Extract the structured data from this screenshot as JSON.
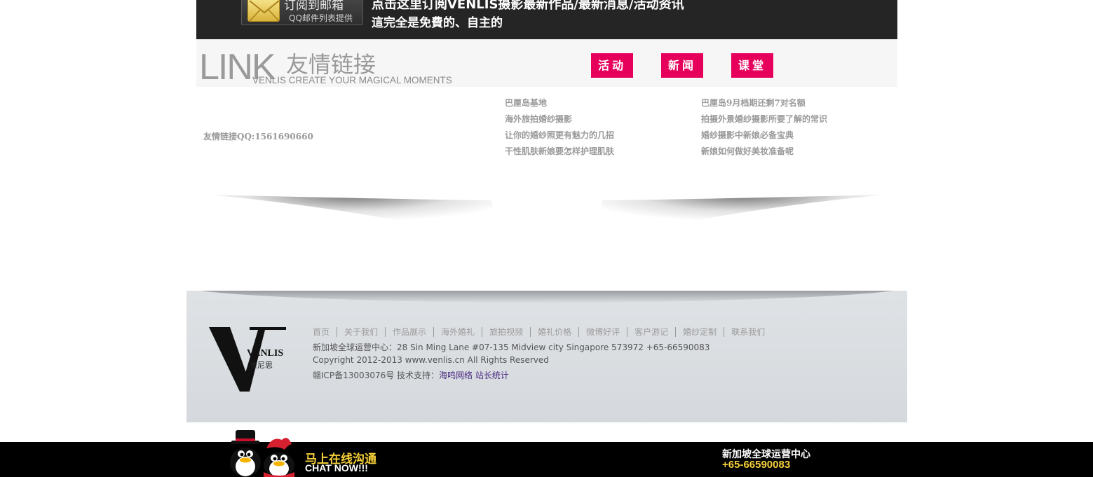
{
  "subscribe": {
    "mail_title": "订阅到邮箱",
    "mail_sub": "QQ邮件列表提供",
    "line1": "点击这里订阅VENLIS摄影最新作品/最新消息/活动资讯",
    "line2": "這完全是免費的、自主的"
  },
  "link_header": {
    "logo_big": "LINK",
    "logo_cn": "友情链接",
    "logo_en": "VENLIS CREATE YOUR MAGICAL MOMENTS",
    "tabs": [
      {
        "label": "活动"
      },
      {
        "label": "新闻"
      },
      {
        "label": "课堂"
      }
    ]
  },
  "friend_link_qq": "友情链接QQ:1561690660",
  "news_left": [
    "巴厘岛基地",
    "海外旅拍婚纱摄影",
    "让你的婚纱照更有魅力的几招",
    "干性肌肤新娘要怎样护理肌肤"
  ],
  "news_right": [
    "巴厘岛9月档期还剩7对名额",
    "拍摄外景婚纱摄影所要了解的常识",
    "婚纱摄影中新娘必备宝典",
    "新娘如何做好美妆准备呢"
  ],
  "footer": {
    "logo_text": "VENLIS",
    "logo_cn": "惟尼思",
    "nav": [
      "首页",
      "关于我们",
      "作品展示",
      "海外婚礼",
      "旅拍视频",
      "婚礼价格",
      "微博好评",
      "客户游记",
      "婚纱定制",
      "联系我们"
    ],
    "address": "新加坡全球运营中心：28 Sin Ming Lane #07-135 Midview city Singapore 573972 +65-66590083",
    "copyright": "Copyright 2012-2013 www.venlis.cn All Rights Reserved",
    "icp": "赣ICP备13003076号 技术支持：",
    "support_link": "海鸣网络",
    "stats_link": "站长统计"
  },
  "chat_bar": {
    "cta_cn": "马上在线沟通",
    "cta_en": "CHAT NOW!!!",
    "hq": "新加坡全球运营中心",
    "phone": "+65-66590083"
  },
  "colors": {
    "accent_pink": "#e6005c",
    "dark_bar": "#252525",
    "cta_yellow": "#f5d03a",
    "link_purple": "#4a2a82"
  }
}
